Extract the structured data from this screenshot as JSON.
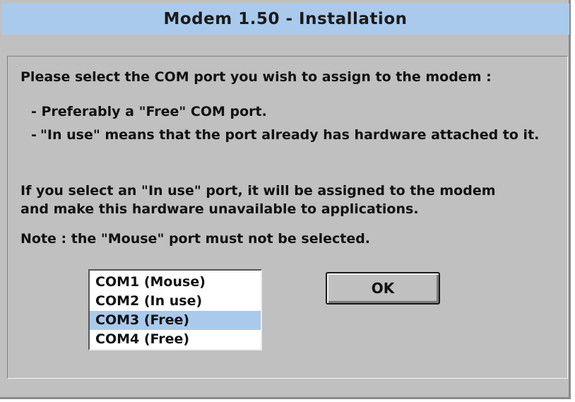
{
  "window": {
    "title": "Modem  1.50 - Installation"
  },
  "instructions": {
    "intro": "Please select the COM port you wish to assign to the modem :",
    "bullet1": "- Preferably a \"Free\" COM port.",
    "bullet2_dash": "-",
    "bullet2": "\"In use\" means that the port already has hardware attached to it.",
    "warning_line1": "If you select an \"In use\" port, it will be assigned to the modem",
    "warning_line2": "and make this hardware unavailable to applications.",
    "note": "Note : the \"Mouse\" port must not be selected."
  },
  "com_ports": {
    "items": [
      {
        "label": "COM1 (Mouse)"
      },
      {
        "label": "COM2 (In use)"
      },
      {
        "label": "COM3 (Free)"
      },
      {
        "label": "COM4 (Free)"
      }
    ],
    "selected_label": "COM3 (Free)"
  },
  "buttons": {
    "ok_label": "OK"
  },
  "colors": {
    "dialog_background": "#c0c0c0",
    "title_bar": "#a9caec",
    "selection_highlight": "#a9caec"
  }
}
